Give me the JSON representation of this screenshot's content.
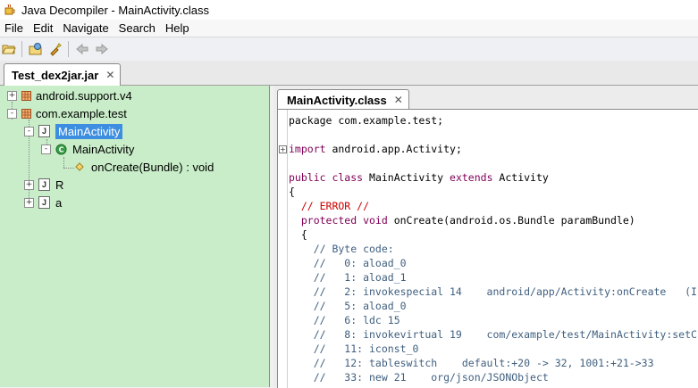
{
  "window": {
    "title": "Java Decompiler - MainActivity.class"
  },
  "menu": [
    "File",
    "Edit",
    "Navigate",
    "Search",
    "Help"
  ],
  "outer_tab": {
    "label": "Test_dex2jar.jar"
  },
  "tree": {
    "items": [
      {
        "label": "android.support.v4",
        "kind": "package",
        "expander": "+"
      },
      {
        "label": "com.example.test",
        "kind": "package",
        "expander": "-"
      },
      {
        "label": "MainActivity",
        "kind": "class-file",
        "expander": "-",
        "selected": true
      },
      {
        "label": "MainActivity",
        "kind": "class",
        "expander": "-"
      },
      {
        "label": "onCreate(Bundle) : void",
        "kind": "method"
      },
      {
        "label": "R",
        "kind": "class-file",
        "expander": "+"
      },
      {
        "label": "a",
        "kind": "class-file",
        "expander": "+"
      }
    ]
  },
  "editor_tab": {
    "label": "MainActivity.class"
  },
  "code": [
    {
      "parts": [
        {
          "t": "package com.example.test;",
          "c": "pln"
        }
      ]
    },
    {
      "parts": []
    },
    {
      "parts": [
        {
          "t": "import",
          "c": "kw"
        },
        {
          "t": " android.app.Activity;",
          "c": "pln"
        }
      ],
      "fold": "+"
    },
    {
      "parts": []
    },
    {
      "parts": [
        {
          "t": "public class",
          "c": "kw"
        },
        {
          "t": " MainActivity ",
          "c": "pln"
        },
        {
          "t": "extends",
          "c": "kw"
        },
        {
          "t": " Activity",
          "c": "pln"
        }
      ]
    },
    {
      "parts": [
        {
          "t": "{",
          "c": "pln"
        }
      ]
    },
    {
      "parts": [
        {
          "t": "  // ERROR //",
          "c": "err"
        }
      ]
    },
    {
      "parts": [
        {
          "t": "  protected void",
          "c": "kw"
        },
        {
          "t": " onCreate(android.os.Bundle paramBundle)",
          "c": "pln"
        }
      ]
    },
    {
      "parts": [
        {
          "t": "  {",
          "c": "pln"
        }
      ]
    },
    {
      "parts": [
        {
          "t": "    // Byte code:",
          "c": "cm"
        }
      ]
    },
    {
      "parts": [
        {
          "t": "    //   0: aload_0",
          "c": "cm"
        }
      ]
    },
    {
      "parts": [
        {
          "t": "    //   1: aload_1",
          "c": "cm"
        }
      ]
    },
    {
      "parts": [
        {
          "t": "    //   2: invokespecial 14    android/app/Activity:onCreate   (I",
          "c": "cm"
        }
      ]
    },
    {
      "parts": [
        {
          "t": "    //   5: aload_0",
          "c": "cm"
        }
      ]
    },
    {
      "parts": [
        {
          "t": "    //   6: ldc 15",
          "c": "cm"
        }
      ]
    },
    {
      "parts": [
        {
          "t": "    //   8: invokevirtual 19    com/example/test/MainActivity:setC",
          "c": "cm"
        }
      ]
    },
    {
      "parts": [
        {
          "t": "    //   11: iconst_0",
          "c": "cm"
        }
      ]
    },
    {
      "parts": [
        {
          "t": "    //   12: tableswitch    default:+20 -> 32, 1001:+21->33",
          "c": "cm"
        }
      ]
    },
    {
      "parts": [
        {
          "t": "    //   33: new 21    org/json/JSONObject",
          "c": "cm"
        }
      ]
    }
  ]
}
